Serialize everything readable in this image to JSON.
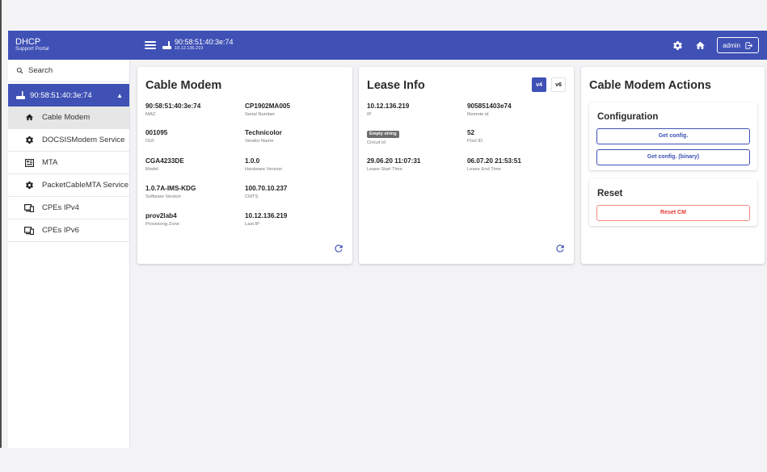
{
  "brand": {
    "title": "DHCP",
    "subtitle": "Support Portal"
  },
  "header": {
    "device_mac": "90:58:51:40:3e:74",
    "device_ip": "10.12.136.219",
    "user_label": "admin"
  },
  "sidebar": {
    "search_label": "Search",
    "device": {
      "mac": "90:58:51:40:3e:74"
    },
    "items": [
      {
        "label": "Cable Modem",
        "icon": "home-icon",
        "active": true
      },
      {
        "label": "DOCSISModem Service",
        "icon": "gear-icon"
      },
      {
        "label": "MTA",
        "icon": "mta-icon"
      },
      {
        "label": "PacketCableMTA Service",
        "icon": "gear-icon"
      },
      {
        "label": "CPEs IPv4",
        "icon": "cpe-icon"
      },
      {
        "label": "CPEs IPv6",
        "icon": "cpe-icon"
      }
    ]
  },
  "cable_modem": {
    "title": "Cable Modem",
    "fields": [
      {
        "value": "90:58:51:40:3e:74",
        "label": "MAC"
      },
      {
        "value": "CP1902MA005",
        "label": "Serial Number"
      },
      {
        "value": "001095",
        "label": "OUI"
      },
      {
        "value": "Technicolor",
        "label": "Vendor Name"
      },
      {
        "value": "CGA4233DE",
        "label": "Model"
      },
      {
        "value": "1.0.0",
        "label": "Hardware Version"
      },
      {
        "value": "1.0.7A-IMS-KDG",
        "label": "Software Version"
      },
      {
        "value": "100.70.10.237",
        "label": "CMTS"
      },
      {
        "value": "prov2lab4",
        "label": "Provisiong Zone"
      },
      {
        "value": "10.12.136.219",
        "label": "Last IP"
      }
    ]
  },
  "lease_info": {
    "title": "Lease Info",
    "v4_label": "v4",
    "v6_label": "v6",
    "fields": [
      {
        "value": "10.12.136.219",
        "label": "IP"
      },
      {
        "value": "905851403e74",
        "label": "Remote id"
      },
      {
        "value": "Empty string",
        "label": "Circuit Id"
      },
      {
        "value": "52",
        "label": "Pool ID"
      },
      {
        "value": "29.06.20 11:07:31",
        "label": "Lease Start Time"
      },
      {
        "value": "06.07.20 21:53:51",
        "label": "Lease End Time"
      }
    ]
  },
  "actions": {
    "title": "Cable Modem Actions",
    "configuration": {
      "title": "Configuration",
      "get_config": "Get config.",
      "get_config_binary": "Get config. (binary)"
    },
    "reset": {
      "title": "Reset",
      "reset_cm": "Reset CM"
    }
  },
  "colors": {
    "primary": "#3f51b5",
    "danger": "#e53935",
    "chip": "#6d6d6d"
  }
}
